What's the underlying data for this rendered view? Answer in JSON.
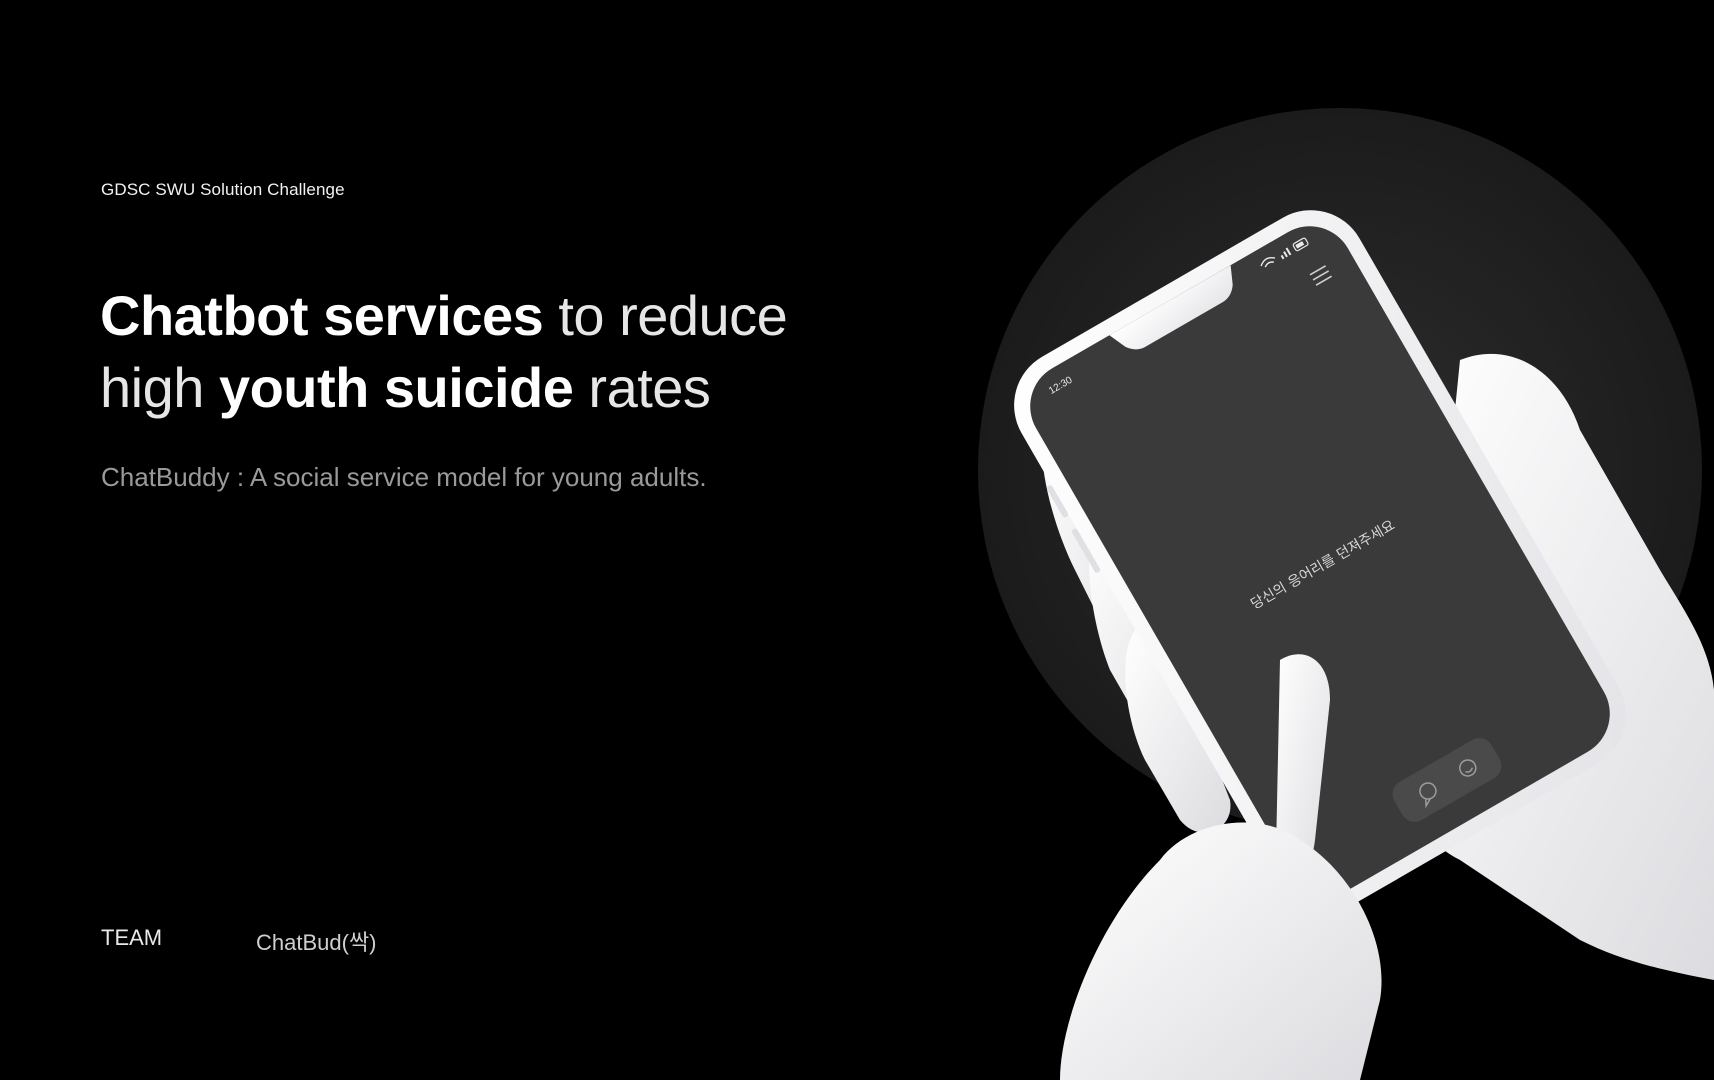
{
  "header": {
    "eyebrow": "GDSC SWU Solution Challenge"
  },
  "headline": {
    "line1": {
      "bold": "Chatbot services",
      "light": " to reduce"
    },
    "line2": {
      "light_start": "high ",
      "bold": "youth suicide",
      "light_end": " rates"
    }
  },
  "subline": "ChatBuddy : A social service model for young adults.",
  "team": {
    "label": "TEAM",
    "name": "ChatBud(싹)"
  },
  "phone": {
    "time": "12:30",
    "prompt": "당신의 응어리를 던져주세요",
    "icons": [
      "wifi-icon",
      "signal-icon",
      "battery-icon",
      "menu-icon",
      "chat-bubble-icon",
      "smile-icon"
    ]
  },
  "colors": {
    "background": "#000000",
    "circle": "#222222",
    "screen": "#3a3a3a",
    "hand": "#f4f4f6"
  }
}
